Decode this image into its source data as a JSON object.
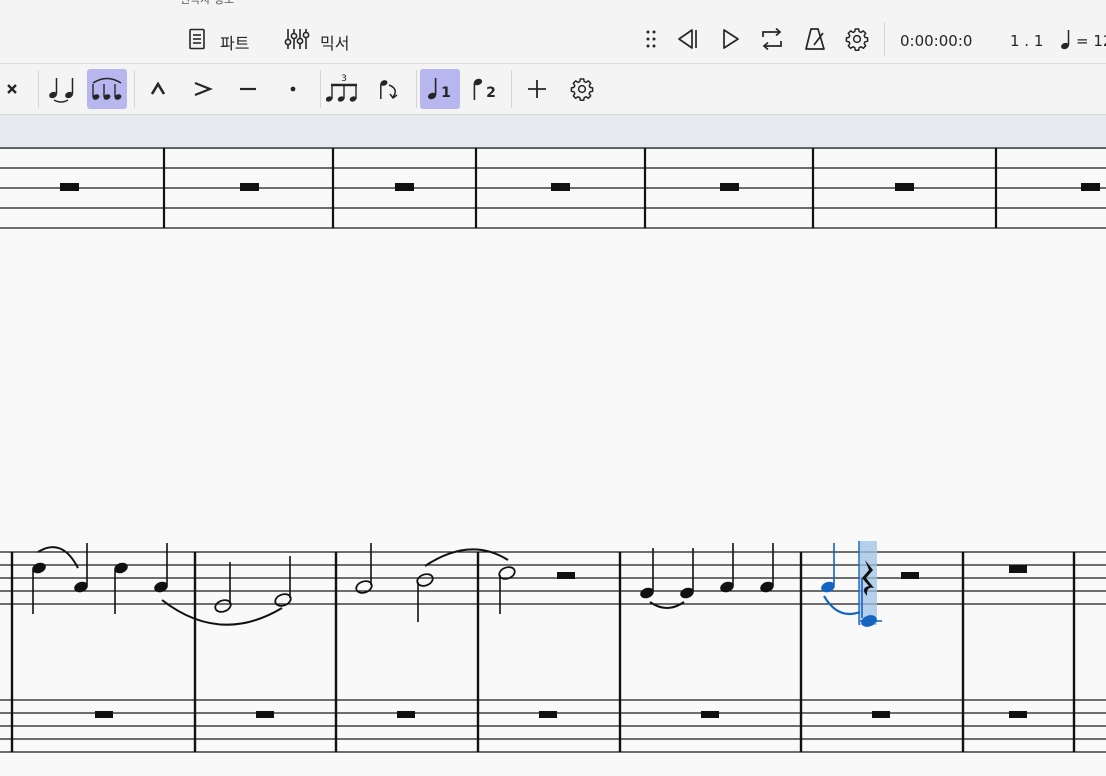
{
  "top": {
    "cut_label": "편곡자 정보",
    "parts_label": "파트",
    "mixer_label": "믹서",
    "time": "0:00:00:0",
    "position": "1 . 1",
    "tempo": "= 12"
  },
  "icons": {
    "parts": "parts-document-icon",
    "mixer": "mixer-sliders-icon",
    "drag": "drag-handle-icon",
    "rewind": "rewind-icon",
    "play": "play-icon",
    "loop": "loop-icon",
    "metronome": "metronome-icon",
    "settings": "gear-icon"
  },
  "toolbar": {
    "tuplet_number": "3",
    "voice1": "1",
    "voice2": "2"
  },
  "colors": {
    "selected_note": "#1565c0",
    "selection_highlight": "#9cc2e5",
    "active_tool": "#b8b6ee"
  }
}
